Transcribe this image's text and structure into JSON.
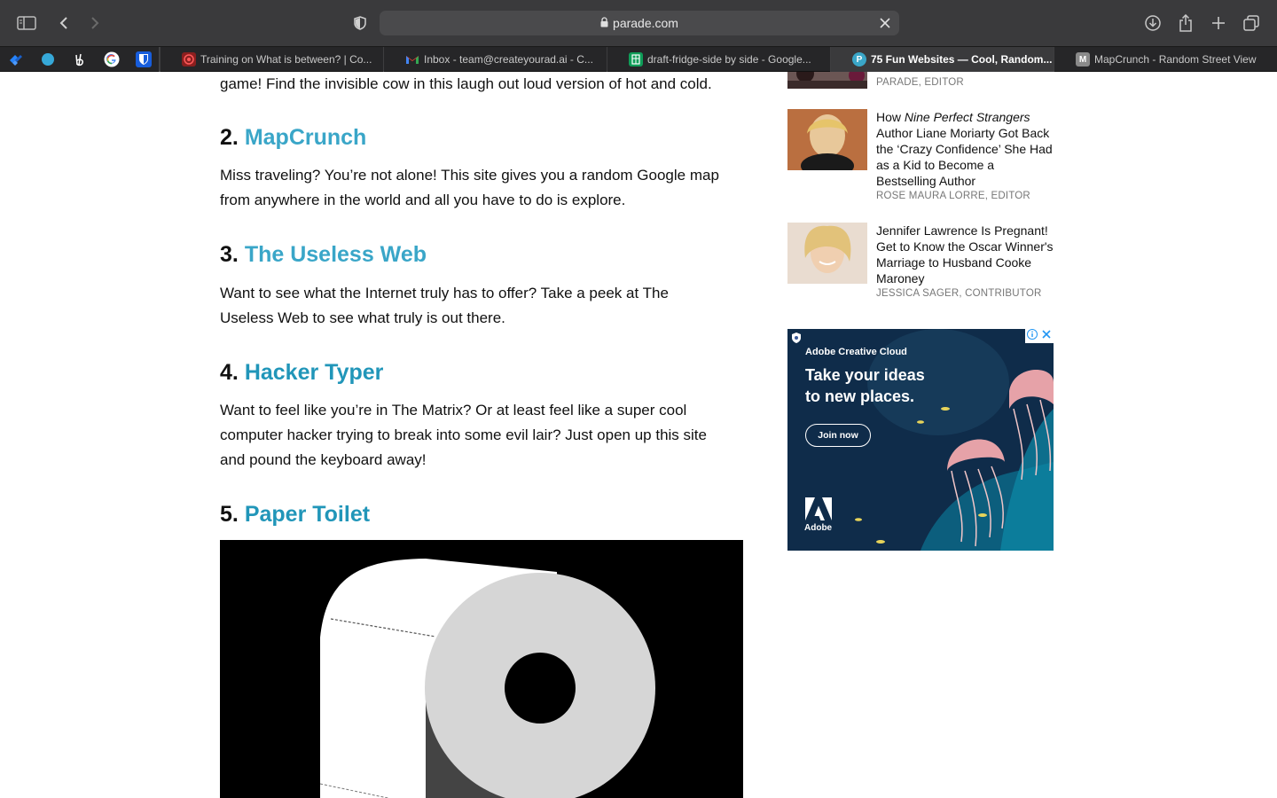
{
  "browser": {
    "url": "parade.com",
    "pinned_tabs": [
      "jira-icon",
      "circle-icon",
      "peace-icon",
      "google-icon",
      "bitwarden-icon"
    ],
    "tabs": [
      {
        "label": "Training on What is between? | Co...",
        "favicon": "target-icon",
        "color": "#c0392b"
      },
      {
        "label": "Inbox - team@createyourad.ai - C...",
        "favicon": "gmail-icon",
        "color": "#ea4335"
      },
      {
        "label": "draft-fridge-side by side - Google...",
        "favicon": "sheets-icon",
        "color": "#0f9d58"
      },
      {
        "label": "75 Fun Websites — Cool, Random...",
        "favicon": "parade-icon",
        "color": "#3aa6c8",
        "active": true
      },
      {
        "label": "MapCrunch - Random Street View",
        "favicon": "m-icon",
        "color": "#777777"
      }
    ]
  },
  "article": {
    "intro_line": "game! Find the invisible cow in this laugh out loud version of hot and cold.",
    "sections": [
      {
        "num": "2.",
        "title": "MapCrunch",
        "lines": [
          "Miss traveling? You’re not alone! This site gives you a random Google map",
          "from anywhere in the world and all you have to do is explore."
        ]
      },
      {
        "num": "3.",
        "title": "The Useless Web",
        "lines": [
          "Want to see what the Internet truly has to offer? Take a peek at The",
          "Useless Web to see what truly is out there."
        ]
      },
      {
        "num": "4.",
        "title": "Hacker Typer",
        "lines": [
          "Want to feel like you’re in The Matrix? Or at least feel like a super cool",
          "computer hacker trying to break into some evil lair? Just open up this site",
          "and pound the keyboard away!"
        ]
      },
      {
        "num": "5.",
        "title": "Paper Toilet",
        "lines": []
      }
    ]
  },
  "sidebar": {
    "stories": [
      {
        "author": "PARADE, EDITOR"
      },
      {
        "title_prefix": "How ",
        "title_em": "Nine Perfect Strangers",
        "title_rest": " Author Liane Moriarty Got Back the ‘Crazy Confidence’ She Had as a Kid to Become a Bestselling Author",
        "author": "ROSE MAURA LORRE, EDITOR"
      },
      {
        "title_prefix": "Jennifer Lawrence Is Pregnant! Get to Know the Oscar Winner's Marriage to Husband Cooke Maroney",
        "title_em": "",
        "title_rest": "",
        "author": "JESSICA SAGER, CONTRIBUTOR"
      }
    ],
    "ad": {
      "brand": "Adobe Creative Cloud",
      "headline": "Take your ideas to new places.",
      "cta": "Join now",
      "logo_text": "Adobe"
    }
  }
}
